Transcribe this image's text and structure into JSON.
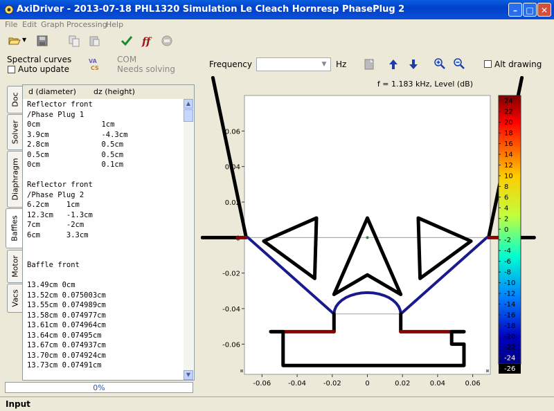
{
  "window": {
    "title": "AxiDriver - 2013-07-18 PHL1320 Simulation Le Cleach Hornresp PhasePlug 2",
    "minimize_label": "–",
    "maximize_label": "□",
    "close_label": "✕"
  },
  "menu": {
    "items": [
      "File",
      "Edit",
      "Graph",
      "Processing",
      "Help"
    ]
  },
  "toolbar": {
    "icons": [
      "open-folder-icon",
      "save-icon",
      "copy-icon",
      "paste-icon",
      "check-icon",
      "function-icon",
      "stop-icon"
    ]
  },
  "left_panel": {
    "spectral_curves_label": "Spectral curves",
    "auto_update_label": "Auto update",
    "auto_update_checked": false,
    "vacs_logo": "VACS",
    "com_label": "COM",
    "needs_solving_label": "Needs solving"
  },
  "tabs": [
    {
      "label": "Doc",
      "active": false
    },
    {
      "label": "Solver",
      "active": false
    },
    {
      "label": "Diaphragm",
      "active": false
    },
    {
      "label": "Baffles",
      "active": true
    },
    {
      "label": "Motor",
      "active": false
    },
    {
      "label": "Vacs",
      "active": false
    }
  ],
  "editor": {
    "col_diameter": "d (diameter)",
    "col_height": "dz (height)",
    "lines": [
      "Reflector front",
      "/Phase Plug 1",
      "0cm              1cm",
      "3.9cm            -4.3cm",
      "2.8cm            0.5cm",
      "0.5cm            0.5cm",
      "0cm              0.1cm",
      "",
      "Reflector front",
      "/Phase Plug 2",
      "6.2cm    1cm",
      "12.3cm   -1.3cm",
      "7cm      -2cm",
      "6cm      3.3cm",
      "",
      "",
      "Baffle front",
      "",
      "13.49cm 0cm",
      "13.52cm 0.075003cm",
      "13.55cm 0.074989cm",
      "13.58cm 0.074977cm",
      "13.61cm 0.074964cm",
      "13.64cm 0.07495cm",
      "13.67cm 0.074937cm",
      "13.70cm 0.074924cm",
      "13.73cm 0.07491cm"
    ]
  },
  "progress": {
    "text": "0%",
    "value": 0
  },
  "status": {
    "text": "Input"
  },
  "chart_toolbar": {
    "frequency_label": "Frequency",
    "frequency_value": "",
    "unit_label": "Hz",
    "alt_drawing_label": "Alt drawing",
    "alt_drawing_checked": false,
    "icons": [
      "export-icon",
      "arrow-up-icon",
      "arrow-down-icon",
      "zoom-in-icon",
      "zoom-out-icon"
    ]
  },
  "chart_data": {
    "type": "heatmap",
    "title": "f = 1.183 kHz, Level  (dB)",
    "x_ticks": [
      "-0.06",
      "-0.04",
      "-0.02",
      "0",
      "0.02",
      "0.04",
      "0.06"
    ],
    "y_ticks": [
      "0.06",
      "0.04",
      "0.02",
      "0",
      "-0.02",
      "-0.04",
      "-0.06"
    ],
    "xlim": [
      -0.07,
      0.07
    ],
    "ylim": [
      -0.077,
      0.08
    ],
    "colorbar": {
      "ticks": [
        24,
        22,
        20,
        18,
        16,
        14,
        12,
        10,
        8,
        6,
        4,
        2,
        0,
        -2,
        -4,
        -6,
        -8,
        -10,
        -12,
        -14,
        -16,
        -18,
        -20,
        -22,
        -24,
        -26
      ],
      "range": [
        -27,
        25
      ]
    },
    "colors": {
      "geometry": "#000000",
      "diaphragm": "#1a1a8c",
      "reflector": "#8b0000",
      "baseline": "#aaaaaa"
    }
  }
}
